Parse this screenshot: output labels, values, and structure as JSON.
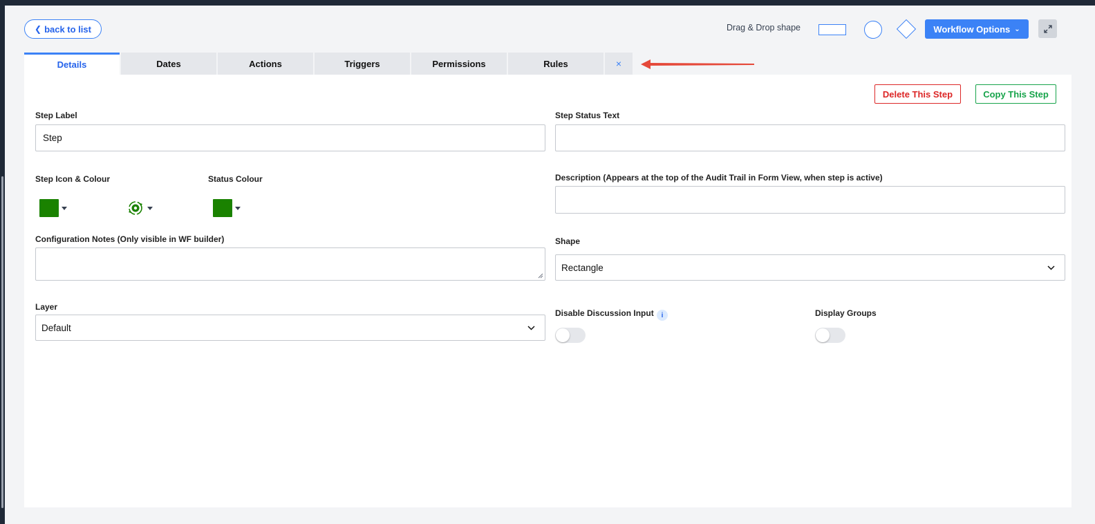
{
  "toolbar": {
    "back_label": "back to list",
    "drag_drop_label": "Drag & Drop shape",
    "workflow_options_label": "Workflow Options"
  },
  "tabs": [
    {
      "label": "Details",
      "active": true
    },
    {
      "label": "Dates"
    },
    {
      "label": "Actions"
    },
    {
      "label": "Triggers"
    },
    {
      "label": "Permissions"
    },
    {
      "label": "Rules"
    },
    {
      "label": "×"
    }
  ],
  "actions": {
    "delete_label": "Delete This Step",
    "copy_label": "Copy This Step"
  },
  "form": {
    "step_label": {
      "label": "Step Label",
      "value": "Step"
    },
    "step_status_text": {
      "label": "Step Status Text",
      "value": ""
    },
    "step_icon_colour": {
      "label": "Step Icon & Colour"
    },
    "status_colour": {
      "label": "Status Colour"
    },
    "description": {
      "label": "Description (Appears at the top of the Audit Trail in Form View, when step is active)",
      "value": ""
    },
    "config_notes": {
      "label": "Configuration Notes (Only visible in WF builder)",
      "value": ""
    },
    "shape": {
      "label": "Shape",
      "value": "Rectangle"
    },
    "layer": {
      "label": "Layer",
      "value": "Default"
    },
    "disable_discussion": {
      "label": "Disable Discussion Input",
      "on": false
    },
    "display_groups": {
      "label": "Display Groups",
      "on": false
    }
  },
  "colors": {
    "accent": "#3b82f6",
    "delete": "#dc2626",
    "copy": "#16a34a",
    "step_colour": "#1a8200",
    "annotation_arrow": "#e5493a"
  }
}
